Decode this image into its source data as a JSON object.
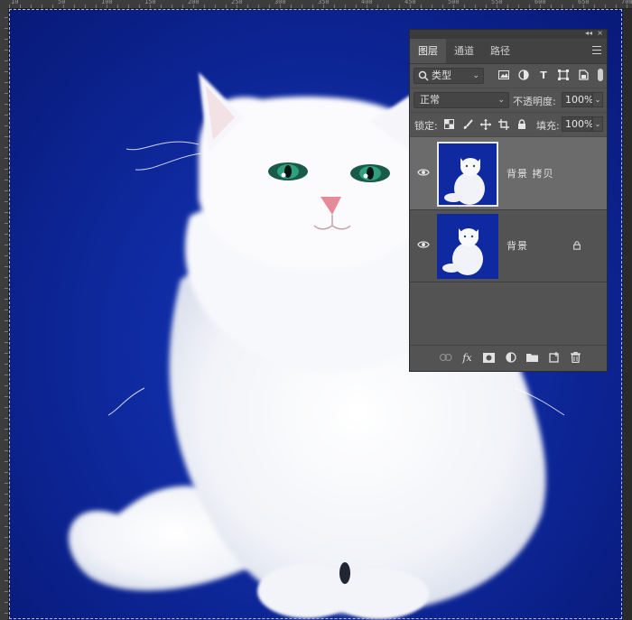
{
  "ruler": {
    "labels": [
      "10",
      "50",
      "100",
      "150",
      "200",
      "250",
      "300",
      "350",
      "400",
      "450",
      "500",
      "550",
      "600",
      "650",
      "700"
    ]
  },
  "layers_panel": {
    "tabs": [
      {
        "label": "图层",
        "active": true
      },
      {
        "label": "通道",
        "active": false
      },
      {
        "label": "路径",
        "active": false
      }
    ],
    "filter": {
      "kind_label": "类型",
      "icons": [
        "image-filter-icon",
        "adjustment-filter-icon",
        "type-filter-icon",
        "shape-filter-icon",
        "smart-object-filter-icon"
      ]
    },
    "blend_mode": "正常",
    "opacity_label": "不透明度:",
    "opacity_value": "100%",
    "lock_label": "锁定:",
    "lock_icons": [
      "lock-transparent-icon",
      "lock-image-icon",
      "lock-position-icon",
      "lock-artboard-icon",
      "lock-all-icon"
    ],
    "fill_label": "填充:",
    "fill_value": "100%",
    "layers": [
      {
        "name": "背景 拷贝",
        "visible": true,
        "selected": true,
        "locked": false
      },
      {
        "name": "背景",
        "visible": true,
        "selected": false,
        "locked": true
      }
    ],
    "footer_icons": [
      "link-layers-icon",
      "fx-icon",
      "mask-icon",
      "adjustment-layer-icon",
      "group-folder-icon",
      "new-layer-icon",
      "trash-icon"
    ],
    "fx_label": "fx"
  },
  "colors": {
    "background_blue": "#0f2aa0",
    "panel_bg": "#535353",
    "selected_layer": "#6b6b6b"
  }
}
